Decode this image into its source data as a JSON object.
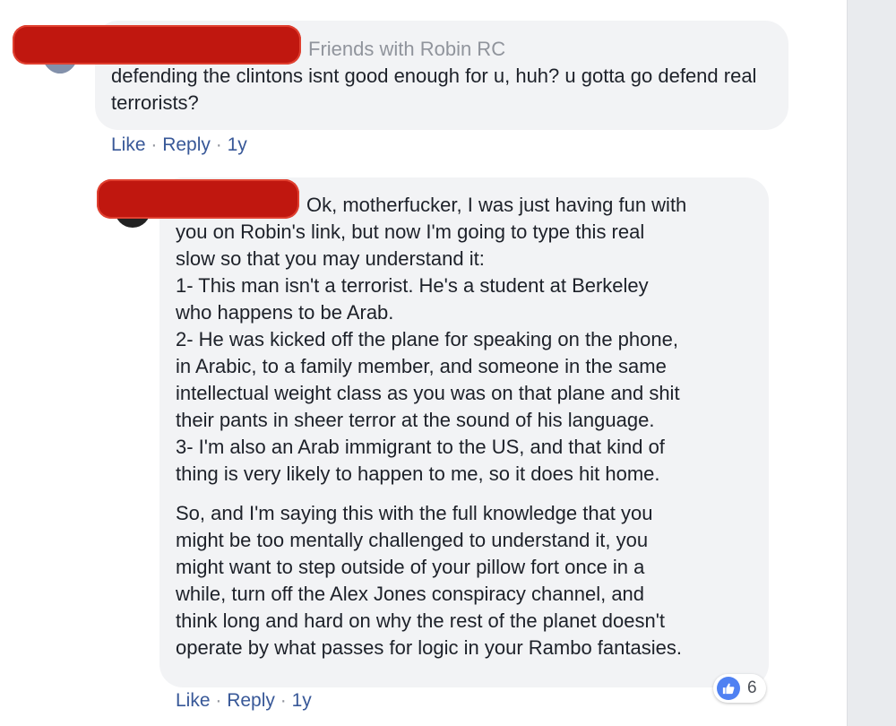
{
  "comment1": {
    "friends_with": "Friends with Robin RC",
    "text": "defending the clintons isnt good enough for u, huh? u gotta go defend real terrorists?",
    "actions": {
      "like": "Like",
      "sep1": " · ",
      "reply": "Reply",
      "sep2": " · ",
      "time": "1y"
    }
  },
  "comment2": {
    "first_line": "Ok, motherfucker, I was just having fun with",
    "paragraph1_rest": [
      "you on Robin's link, but now I'm going to type this real",
      "slow so that you may understand it:",
      "1- This man isn't a terrorist. He's a student at Berkeley",
      "who happens to be Arab.",
      "2- He was kicked off the plane for speaking on the phone,",
      "in Arabic, to a family member, and someone in the same",
      "intellectual weight class as you was on that plane and shit",
      "their pants in sheer terror at the sound of his language.",
      "3- I'm also an Arab immigrant to the US, and that kind of",
      "thing is very likely to happen to me, so it does hit home."
    ],
    "paragraph2": [
      "So, and I'm saying this with the full knowledge that you",
      "might be too mentally challenged to understand it, you",
      "might want to step outside of your pillow fort once in a",
      "while, turn off the Alex Jones conspiracy channel, and",
      "think long and hard on why the rest of the planet doesn't",
      "operate by what passes for logic in your Rambo fantasies."
    ],
    "actions": {
      "like": "Like",
      "sep1": " · ",
      "reply": "Reply",
      "sep2": " · ",
      "time": "1y"
    },
    "reaction": {
      "icon": "thumbs-up-icon",
      "count": "6"
    }
  },
  "colors": {
    "bubble": "#f2f3f5",
    "link": "#385898",
    "meta": "#90949c",
    "redaction": "#c0170f",
    "like_blue": "#4f81f2"
  }
}
